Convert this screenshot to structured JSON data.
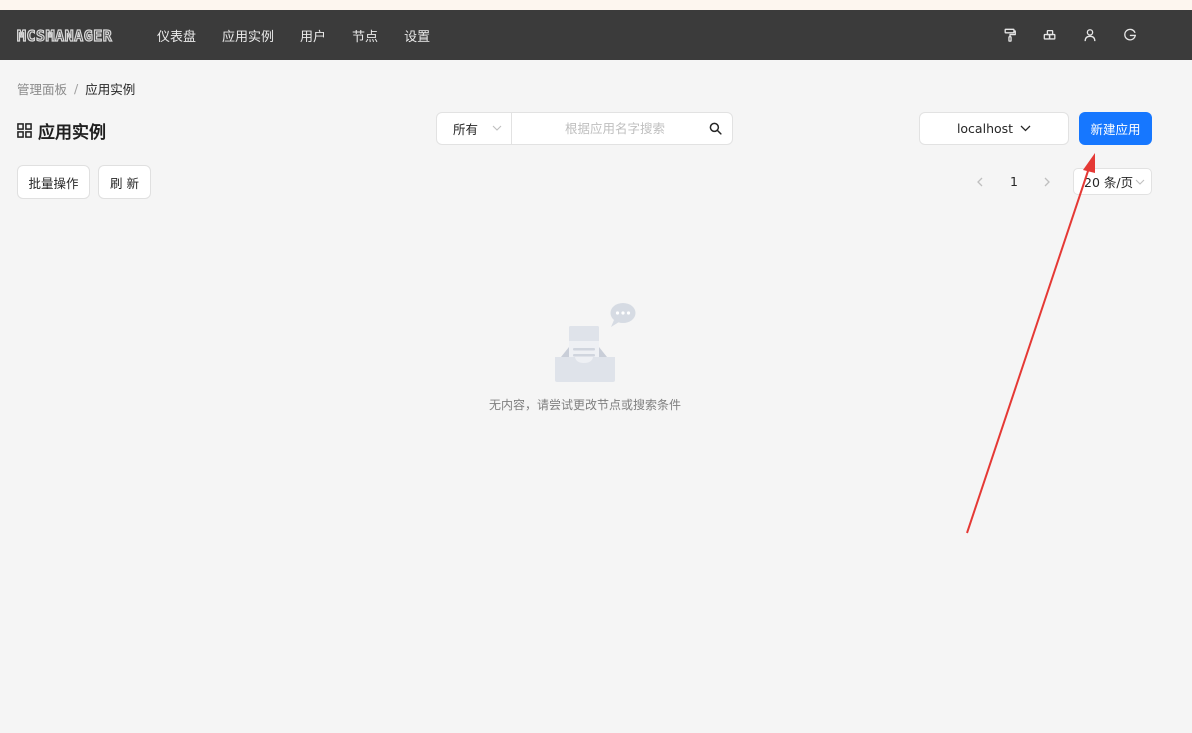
{
  "app": {
    "logo_text": "MCSMANAGER"
  },
  "nav": {
    "items": [
      {
        "label": "仪表盘"
      },
      {
        "label": "应用实例"
      },
      {
        "label": "用户"
      },
      {
        "label": "节点"
      },
      {
        "label": "设置"
      }
    ],
    "icons": [
      "paint-roller-icon",
      "layout-icon",
      "user-icon",
      "logout-icon"
    ]
  },
  "breadcrumb": {
    "root": "管理面板",
    "separator": "/",
    "current": "应用实例"
  },
  "page": {
    "title": "应用实例",
    "title_icon": "grid-icon"
  },
  "search": {
    "filter_value": "所有",
    "placeholder": "根据应用名字搜索"
  },
  "node_select": {
    "value": "localhost"
  },
  "actions": {
    "create_label": "新建应用",
    "batch_label": "批量操作",
    "refresh_label": "刷 新"
  },
  "pagination": {
    "current_page": "1",
    "page_size_label": "20 条/页"
  },
  "empty": {
    "message": "无内容，请尝试更改节点或搜索条件"
  },
  "colors": {
    "navbar": "#3b3b3b",
    "primary": "#1677ff",
    "background": "#f5f5f5",
    "annotation_arrow": "#e53935"
  }
}
